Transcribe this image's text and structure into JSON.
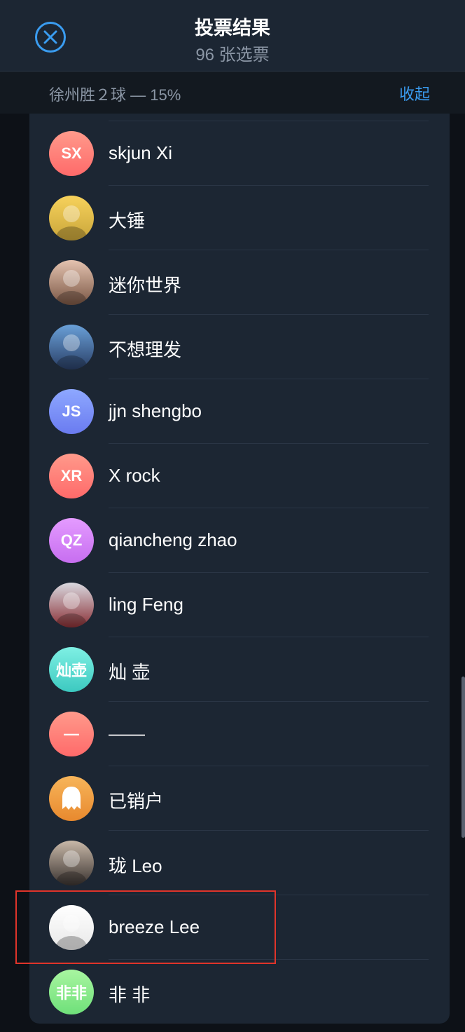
{
  "header": {
    "title": "投票结果",
    "subtitle": "96 张选票"
  },
  "option": {
    "label": "徐州胜２球 — 15%",
    "collapse_label": "收起"
  },
  "voters": [
    {
      "name": "skjun Xi",
      "avatar_type": "initials",
      "initials": "SX",
      "color_from": "#ff9a8b",
      "color_to": "#ff6a6a"
    },
    {
      "name": "大锤",
      "avatar_type": "photo",
      "photo_desc": "person-with-yellow-glasses",
      "color_from": "#f7d25c",
      "color_to": "#c9a53a"
    },
    {
      "name": "迷你世界",
      "avatar_type": "photo",
      "photo_desc": "girl-portrait",
      "color_from": "#e4c3b0",
      "color_to": "#7a5644"
    },
    {
      "name": "不想理发",
      "avatar_type": "photo",
      "photo_desc": "anime-character",
      "color_from": "#6aa0d8",
      "color_to": "#2a3f66"
    },
    {
      "name": "jjn shengbo",
      "avatar_type": "initials",
      "initials": "JS",
      "color_from": "#8ea8ff",
      "color_to": "#6a7bf0"
    },
    {
      "name": "X rock",
      "avatar_type": "initials",
      "initials": "XR",
      "color_from": "#ff9a8b",
      "color_to": "#ff6a6a"
    },
    {
      "name": "qiancheng zhao",
      "avatar_type": "initials",
      "initials": "QZ",
      "color_from": "#e49bff",
      "color_to": "#c76ef0"
    },
    {
      "name": "ling Feng",
      "avatar_type": "photo",
      "photo_desc": "anime-white-hair",
      "color_from": "#d9d9e0",
      "color_to": "#8a2f35"
    },
    {
      "name": "灿 壶",
      "avatar_type": "initials",
      "initials": "灿壶",
      "color_from": "#7ff0e4",
      "color_to": "#3cc9c0"
    },
    {
      "name": "——",
      "avatar_type": "initials",
      "initials": "—",
      "color_from": "#ff9a8b",
      "color_to": "#ff6a6a"
    },
    {
      "name": "已销户",
      "avatar_type": "ghost",
      "color_from": "#f7b55a",
      "color_to": "#e8892e"
    },
    {
      "name": "珑 Leo",
      "avatar_type": "photo",
      "photo_desc": "man-with-glasses",
      "color_from": "#c8b8a8",
      "color_to": "#3a3330"
    },
    {
      "name": "breeze Lee",
      "avatar_type": "photo",
      "photo_desc": "line-drawing-portrait",
      "color_from": "#ffffff",
      "color_to": "#e8e8e8"
    },
    {
      "name": "非 非",
      "avatar_type": "initials",
      "initials": "非非",
      "color_from": "#a8f5a0",
      "color_to": "#6fe07a"
    }
  ]
}
